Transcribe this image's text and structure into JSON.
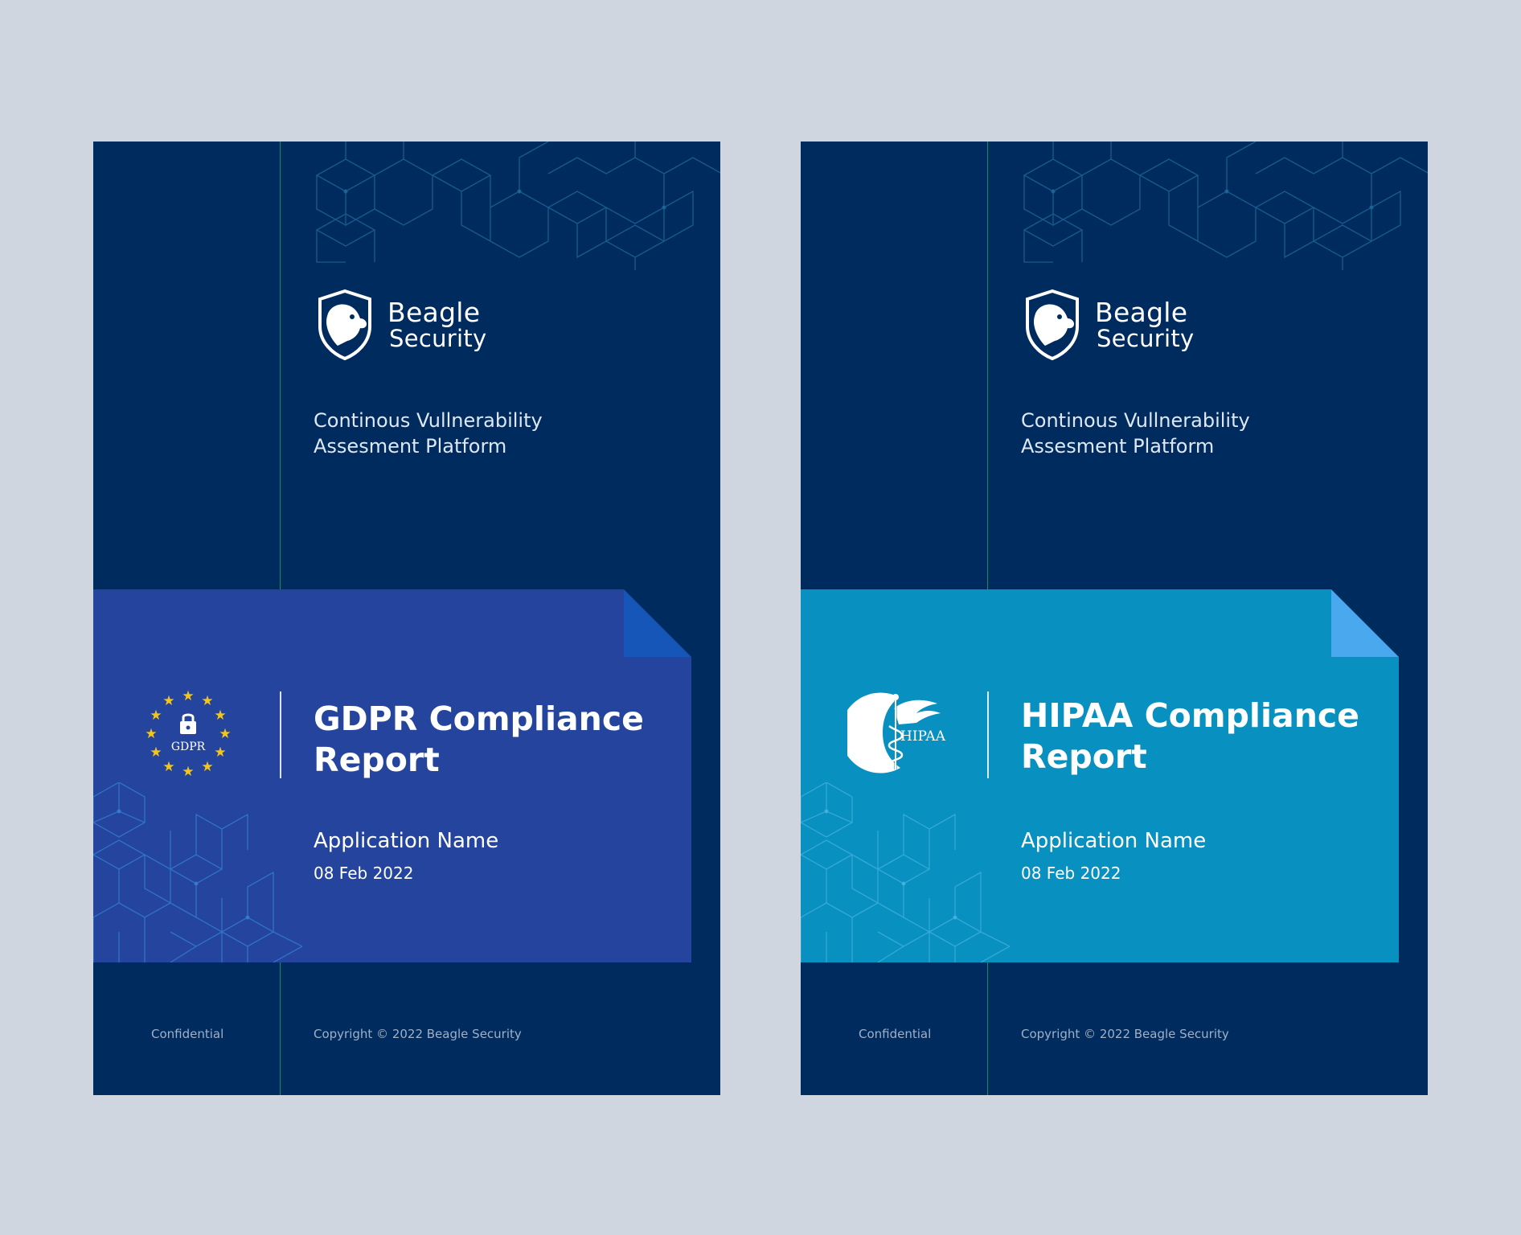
{
  "covers": [
    {
      "id": "gdpr",
      "brand": {
        "line1": "Beagle",
        "line2": "Security"
      },
      "tagline": {
        "line1": "Continous Vullnerability",
        "line2": "Assesment Platform"
      },
      "badge": {
        "icon": "gdpr-stars-lock-icon",
        "text": "GDPR"
      },
      "title": {
        "line1": "GDPR Compliance",
        "line2": "Report"
      },
      "app_name": "Application Name",
      "date": "08 Feb 2022",
      "footer_left": "Confidential",
      "footer_right": "Copyright © 2022 Beagle Security",
      "colors": {
        "background": "#002b5f",
        "band": "#25449d",
        "corner": "#1656b8",
        "accent_line": "#1e8a55"
      }
    },
    {
      "id": "hipaa",
      "brand": {
        "line1": "Beagle",
        "line2": "Security"
      },
      "tagline": {
        "line1": "Continous Vullnerability",
        "line2": "Assesment Platform"
      },
      "badge": {
        "icon": "hipaa-caduceus-icon",
        "text": "HIPAA"
      },
      "title": {
        "line1": "HIPAA Compliance",
        "line2": "Report"
      },
      "app_name": "Application Name",
      "date": "08 Feb 2022",
      "footer_left": "Confidential",
      "footer_right": "Copyright © 2022 Beagle Security",
      "colors": {
        "background": "#002b5f",
        "band": "#0890c0",
        "corner": "#4aa8ee",
        "accent_line": "#1e8a55"
      }
    }
  ]
}
